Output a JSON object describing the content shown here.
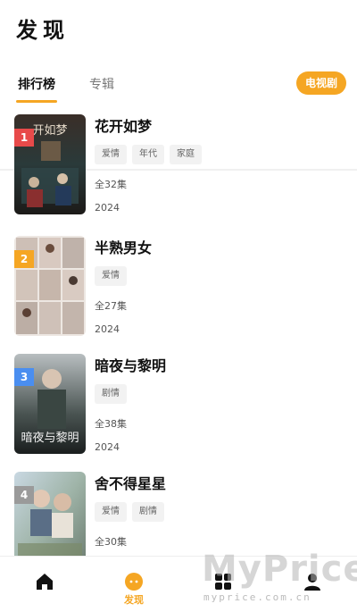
{
  "header": {
    "title": "发现"
  },
  "tabs": {
    "items": [
      {
        "label": "排行榜"
      },
      {
        "label": "专辑"
      }
    ],
    "category_badge": "电视剧"
  },
  "list": {
    "items": [
      {
        "rank": "1",
        "title": "花开如梦",
        "tags": [
          "爱情",
          "年代",
          "家庭"
        ],
        "episodes": "全32集",
        "year": "2024",
        "rank_color": "#e84a4a"
      },
      {
        "rank": "2",
        "title": "半熟男女",
        "tags": [
          "爱情"
        ],
        "episodes": "全27集",
        "year": "2024",
        "rank_color": "#f5a623"
      },
      {
        "rank": "3",
        "title": "暗夜与黎明",
        "tags": [
          "剧情"
        ],
        "episodes": "全38集",
        "year": "2024",
        "rank_color": "#4a8ef0"
      },
      {
        "rank": "4",
        "title": "舍不得星星",
        "tags": [
          "爱情",
          "剧情"
        ],
        "episodes": "全30集",
        "year": "",
        "rank_color": "#9a9a9a"
      }
    ]
  },
  "bottom_nav": {
    "items": [
      {
        "label": "",
        "icon": "home-icon"
      },
      {
        "label": "发现",
        "icon": "discover-icon"
      },
      {
        "label": "",
        "icon": "grid-icon"
      },
      {
        "label": "",
        "icon": "profile-icon"
      }
    ]
  },
  "watermark": {
    "brand": "MyPrice",
    "url": "myprice.com.cn"
  },
  "colors": {
    "accent": "#f5a623"
  }
}
